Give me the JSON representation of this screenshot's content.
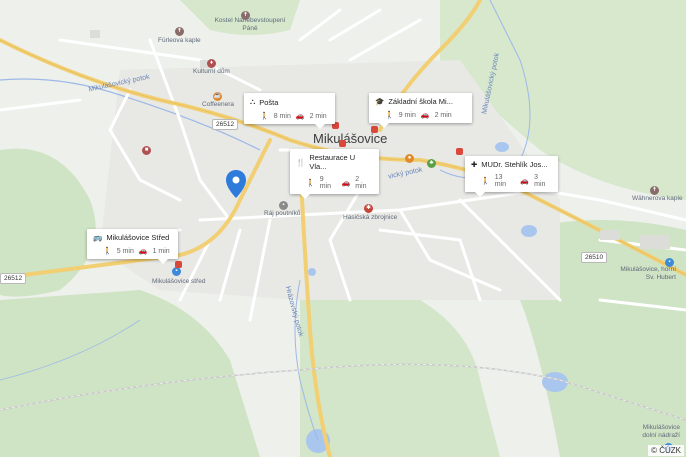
{
  "town": "Mikulášovice",
  "cards": [
    {
      "id": "posta",
      "title": "Pošta",
      "icon": "network-icon",
      "walk": "8 min",
      "drive": "2 min"
    },
    {
      "id": "skola",
      "title": "Základní škola Mi...",
      "icon": "school-icon",
      "walk": "9 min",
      "drive": "2 min"
    },
    {
      "id": "restaurace",
      "title": "Restaurace U Vla...",
      "icon": "restaurant-icon",
      "walk": "9 min",
      "drive": "2 min"
    },
    {
      "id": "lekar",
      "title": "MUDr. Stehlík Jos...",
      "icon": "medical-icon",
      "walk": "13 min",
      "drive": "3 min"
    },
    {
      "id": "bus",
      "title": "Mikulášovice Střed",
      "icon": "bus-icon",
      "walk": "5 min",
      "drive": "1 min"
    }
  ],
  "labels": {
    "kostel": "Kostel Nanebevstoupení Páně",
    "furleova": "Fürleova kaple",
    "kulturni": "Kulturní dům",
    "coffee": "Coffeenera",
    "raj": "Ráj poutníků",
    "hasic": "Hasičská zbrojnice",
    "wahner": "Wähnerova kaple",
    "stred": "Mikulášovice střed",
    "hubert": "Mikulášovice, horní Sv. Hubert",
    "dolni": "Mikulášovice dolní nádraží"
  },
  "water": {
    "mikulasovicky": "Mikulášovický potok",
    "mikulasovicky_east": "Mikulášovický potok",
    "mikulasovicky_short": "vický potok",
    "harrachov": "Hrázovský potok"
  },
  "roads": {
    "r1": "26512",
    "r2": "26512",
    "r3": "26510",
    "r4": "26512"
  },
  "copyright": "© ČÚZK"
}
